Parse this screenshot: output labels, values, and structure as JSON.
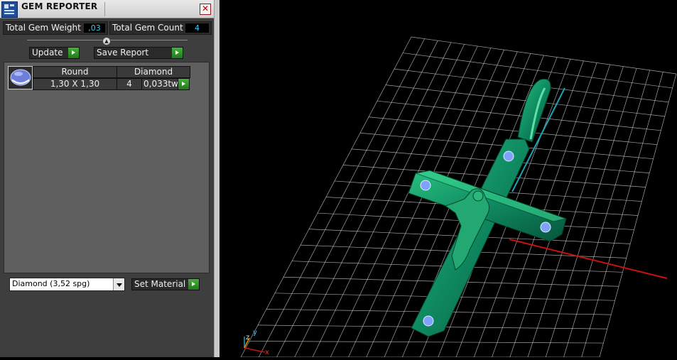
{
  "window": {
    "title": "GEM REPORTER",
    "close_label": "✕"
  },
  "stats": {
    "total_weight_label": "Total Gem Weight",
    "total_weight_value": ",03",
    "total_count_label": "Total Gem Count",
    "total_count_value": "4"
  },
  "toolbar": {
    "update_label": "Update",
    "save_label": "Save Report"
  },
  "gem_table": {
    "headers": [
      "Round",
      "Diamond"
    ],
    "rows": [
      {
        "size": "1,30 X 1,30",
        "count": "4",
        "weight": "0,033tw"
      }
    ]
  },
  "material": {
    "selected": "Diamond     (3,52 spg)",
    "set_label": "Set Material"
  },
  "viewport": {
    "axis_z": "z",
    "axis_y": "y",
    "axis_x": "x"
  },
  "colors": {
    "model": "#0f8a61",
    "gem": "#7fa2ff",
    "axis_x": "#cc1010",
    "axis_y": "#1ea3b3",
    "grid": "#d8d8d8",
    "accent_value": "#35c8ff",
    "go_button": "#2f9a26"
  },
  "icons": [
    "app-icon",
    "close-icon",
    "collapse-arrow-icon",
    "play-arrow-icon",
    "dropdown-arrow-icon",
    "gem-round-icon"
  ]
}
